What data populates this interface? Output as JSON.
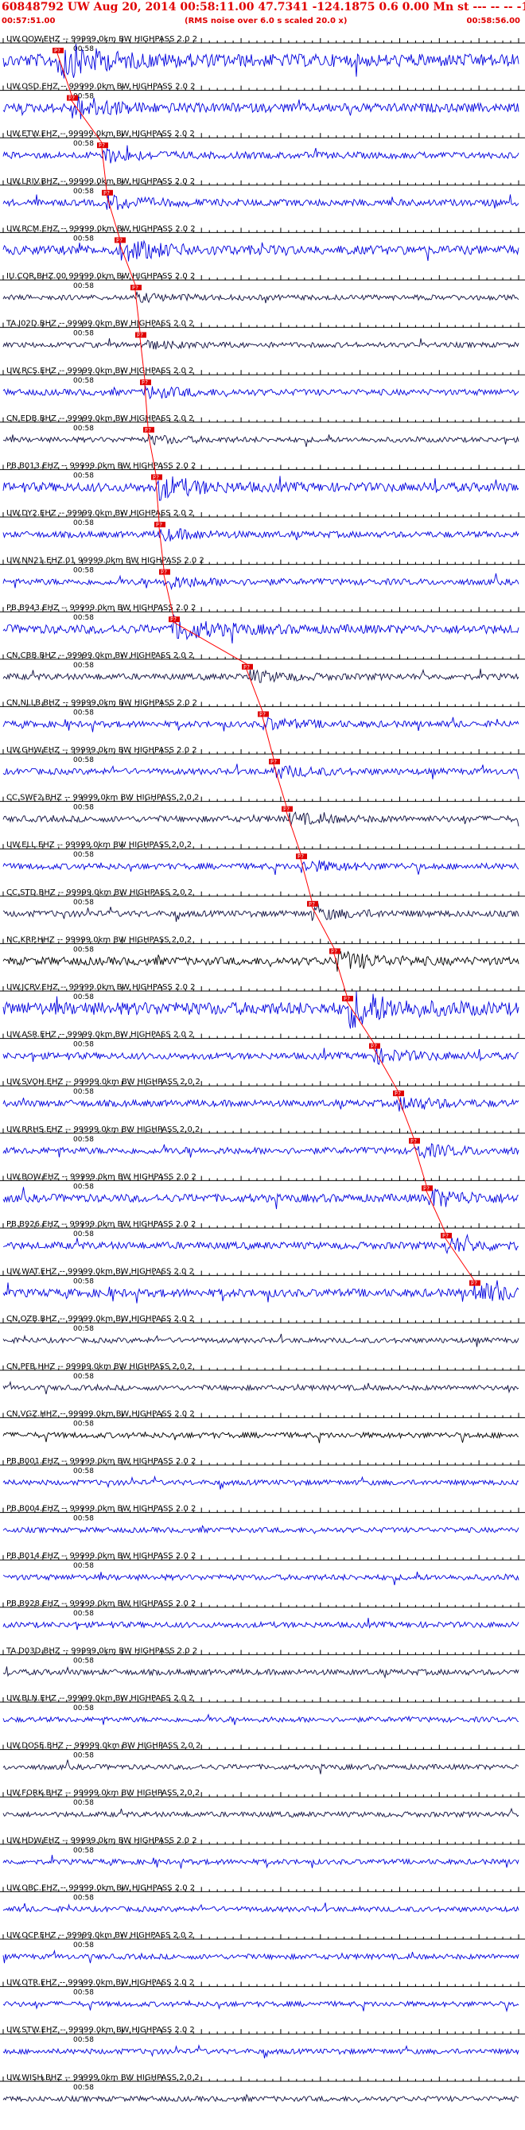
{
  "header": {
    "title": "60848792 UW Aug 20, 2014 00:58:11.00   47.7341 -124.1875  0.6 0.00 Mn st --- -- --  -1",
    "start_time": "00:57:51.00",
    "rms_note": "(RMS noise over 6.0 s scaled 20.0 x)",
    "end_time": "00:58:56.00"
  },
  "minute_mark": "00:58",
  "colors": {
    "header_text": "#e00000",
    "trace_blue": "#0000dd",
    "trace_black": "#000000",
    "trace_dark": "#101040",
    "pick_box": "#dd0000",
    "pick_line": "#ff0000"
  },
  "channels": [
    {
      "label": "UW.OOW.EHZ -- 99999.0km BW  HIGHPASS  2.0  2",
      "color": "blue",
      "energy": 1.0,
      "pick_text": "P?"
    },
    {
      "label": "UW.OSD.EHZ -- 99999.0km BW  HIGHPASS  2.0  2",
      "color": "blue",
      "energy": 0.6,
      "pick_text": "P?"
    },
    {
      "label": "UW.ETW.EHZ -- 99999.0km BW  HIGHPASS  2.0  2",
      "color": "blue",
      "energy": 0.35,
      "pick_text": "P?"
    },
    {
      "label": "UW.LRIV.BHZ -- 99999.0km BW  HIGHPASS  2.0  2",
      "color": "blue",
      "energy": 0.35,
      "pick_text": "P?"
    },
    {
      "label": "UW.RCM.EHZ -- 99999.0km BW  HIGHPASS  2.0  2",
      "color": "blue",
      "energy": 0.6,
      "pick_text": "P?"
    },
    {
      "label": "IU.COR.BHZ.00  99999.0km BW  HIGHPASS  2.0  2",
      "color": "dark",
      "energy": 0.2,
      "pick_text": "P?"
    },
    {
      "label": "TA.I02D.BHZ -- 99999.0km BW  HIGHPASS  2.0  2",
      "color": "dark",
      "energy": 0.2,
      "pick_text": "P?"
    },
    {
      "label": "UW.RCS.EHZ -- 99999.0km BW  HIGHPASS  2.0  2",
      "color": "blue",
      "energy": 0.3,
      "pick_text": "P?"
    },
    {
      "label": "CN.EDB.BHZ -- 99999.0km BW  HIGHPASS  2.0  2",
      "color": "dark",
      "energy": 0.2,
      "pick_text": "P?"
    },
    {
      "label": "PB.B013.EHZ -- 99999.0km BW  HIGHPASS  2.0  2",
      "color": "blue",
      "energy": 0.6,
      "pick_text": "P?"
    },
    {
      "label": "UW.DY2.EHZ -- 99999.0km BW  HIGHPASS  2.0  2",
      "color": "blue",
      "energy": 0.3,
      "pick_text": "P?"
    },
    {
      "label": "UW.NN21.EHZ.01  99999.0km BW  HIGHPASS  2.0  2",
      "color": "blue",
      "energy": 0.3,
      "pick_text": "P?"
    },
    {
      "label": "PB.B943.EHZ -- 99999.0km BW  HIGHPASS  2.0  2",
      "color": "blue",
      "energy": 0.6,
      "pick_text": "P?"
    },
    {
      "label": "CN.CBB.BHZ -- 99999.0km BW  HIGHPASS  2.0  2",
      "color": "dark",
      "energy": 0.3,
      "pick_text": "P?"
    },
    {
      "label": "CN.NLLB.BHZ -- 99999.0km BW  HIGHPASS  2.0  2",
      "color": "blue",
      "energy": 0.3,
      "pick_text": "P?"
    },
    {
      "label": "UW.GHW.EHZ -- 99999.0km BW  HIGHPASS  2.0  2",
      "color": "blue",
      "energy": 0.3,
      "pick_text": "P?"
    },
    {
      "label": "CC.SWF2.BHZ -- 99999.0km BW  HIGHPASS  2.0  2",
      "color": "dark",
      "energy": 0.3,
      "pick_text": "P?"
    },
    {
      "label": "UW.ELL.EHZ -- 99999.0km BW  HIGHPASS  2.0  2",
      "color": "blue",
      "energy": 0.3,
      "pick_text": "P?"
    },
    {
      "label": "CC.STD.BHZ -- 99999.0km BW  HIGHPASS  2.0  2",
      "color": "dark",
      "energy": 0.3,
      "pick_text": "P?"
    },
    {
      "label": "NC.KRP.HHZ -- 99999.0km BW  HIGHPASS  2.0  2",
      "color": "black",
      "energy": 0.5,
      "pick_text": "P?"
    },
    {
      "label": "UW.JCRV.EHZ -- 99999.0km BW  HIGHPASS  2.0  2",
      "color": "blue",
      "energy": 1.0,
      "pick_text": "P?"
    },
    {
      "label": "UW.ASR.EHZ -- 99999.0km BW  HIGHPASS  2.0  2",
      "color": "blue",
      "energy": 0.35,
      "pick_text": "P?"
    },
    {
      "label": "UW.SVOH.EHZ -- 99999.0km BW  HIGHPASS  2.0  2",
      "color": "blue",
      "energy": 0.35,
      "pick_text": "P?"
    },
    {
      "label": "UW.RRHS.EHZ -- 99999.0km BW  HIGHPASS  2.0  2",
      "color": "blue",
      "energy": 0.35,
      "pick_text": "P?"
    },
    {
      "label": "UW.BOW.EHZ -- 99999.0km BW  HIGHPASS  2.0  2",
      "color": "blue",
      "energy": 0.5,
      "pick_text": "P?"
    },
    {
      "label": "PB.B926.EHZ -- 99999.0km BW  HIGHPASS  2.0  2",
      "color": "blue",
      "energy": 0.4,
      "pick_text": "P?"
    },
    {
      "label": "UW.WAT.EHZ -- 99999.0km BW  HIGHPASS  2.0  2",
      "color": "blue",
      "energy": 0.5,
      "pick_text": "P?"
    },
    {
      "label": "CN.OZB.BHZ -- 99999.0km BW  HIGHPASS  2.0  2",
      "color": "dark",
      "energy": 0.2,
      "pick_text": ""
    },
    {
      "label": "CN.PFB.HHZ -- 99999.0km BW  HIGHPASS  2.0  2",
      "color": "dark",
      "energy": 0.2,
      "pick_text": ""
    },
    {
      "label": "CN.VGZ.HHZ -- 99999.0km BW  HIGHPASS  2.0  2",
      "color": "black",
      "energy": 0.25,
      "pick_text": ""
    },
    {
      "label": "PB.B001.EHZ -- 99999.0km BW  HIGHPASS  2.0  2",
      "color": "blue",
      "energy": 0.2,
      "pick_text": ""
    },
    {
      "label": "PB.B004.EHZ -- 99999.0km BW  HIGHPASS  2.0  2",
      "color": "blue",
      "energy": 0.2,
      "pick_text": ""
    },
    {
      "label": "PB.B014.EHZ -- 99999.0km BW  HIGHPASS  2.0  2",
      "color": "blue",
      "energy": 0.25,
      "pick_text": ""
    },
    {
      "label": "PB.B928.EHZ -- 99999.0km BW  HIGHPASS  2.0  2",
      "color": "blue",
      "energy": 0.25,
      "pick_text": ""
    },
    {
      "label": "TA.D03D.BHZ -- 99999.0km BW  HIGHPASS  2.0  2",
      "color": "dark",
      "energy": 0.25,
      "pick_text": ""
    },
    {
      "label": "UW.BLN.EHZ -- 99999.0km BW  HIGHPASS  2.0  2",
      "color": "blue",
      "energy": 0.2,
      "pick_text": ""
    },
    {
      "label": "UW.DOSE.BHZ -- 99999.0km BW  HIGHPASS  2.0  2",
      "color": "dark",
      "energy": 0.2,
      "pick_text": ""
    },
    {
      "label": "UW.FORK.BHZ -- 99999.0km BW  HIGHPASS  2.0  2",
      "color": "dark",
      "energy": 0.2,
      "pick_text": ""
    },
    {
      "label": "UW.HDW.EHZ -- 99999.0km BW  HIGHPASS  2.0  2",
      "color": "blue",
      "energy": 0.2,
      "pick_text": ""
    },
    {
      "label": "UW.OBC.EHZ -- 99999.0km BW  HIGHPASS  2.0  2",
      "color": "blue",
      "energy": 0.2,
      "pick_text": ""
    },
    {
      "label": "UW.OCP.EHZ -- 99999.0km BW  HIGHPASS  2.0  2",
      "color": "blue",
      "energy": 0.2,
      "pick_text": ""
    },
    {
      "label": "UW.OTR.EHZ -- 99999.0km BW  HIGHPASS  2.0  2",
      "color": "blue",
      "energy": 0.2,
      "pick_text": ""
    },
    {
      "label": "UW.STW.EHZ -- 99999.0km BW  HIGHPASS  2.0  2",
      "color": "blue",
      "energy": 0.2,
      "pick_text": ""
    },
    {
      "label": "UW.WISH.BHZ -- 99999.0km BW  HIGHPASS  2.0  2",
      "color": "dark",
      "energy": 0.2,
      "pick_text": ""
    }
  ]
}
